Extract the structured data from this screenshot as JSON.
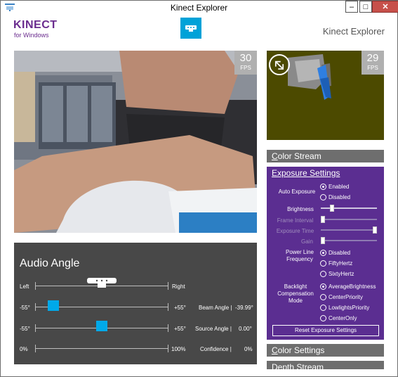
{
  "window": {
    "title": "Kinect Explorer",
    "minimize_glyph": "–",
    "maximize_glyph": "□",
    "close_glyph": "✕"
  },
  "header": {
    "logo_text": "KINECT",
    "logo_sub": "for Windows",
    "app_title": "Kinect Explorer"
  },
  "color_view": {
    "fps": "30",
    "fps_label": "FPS"
  },
  "depth_view": {
    "fps": "29",
    "fps_label": "FPS"
  },
  "audio": {
    "title": "Audio Angle",
    "left_label": "Left",
    "right_label": "Right",
    "beam": {
      "min": "-55°",
      "max": "+55°",
      "label": "Beam Angle |",
      "value": "-39.99°",
      "fraction": 0.136
    },
    "source": {
      "min": "-55°",
      "max": "+55°",
      "label": "Source Angle |",
      "value": "0.00°",
      "fraction": 0.5
    },
    "confidence": {
      "min": "0%",
      "max": "100%",
      "label": "Confidence |",
      "value": "0%"
    }
  },
  "sections": {
    "color_stream": "Color Stream",
    "color_stream_key": "C",
    "color_stream_rest": "olor Stream",
    "exposure_settings": "Exposure Settings",
    "color_settings_key": "C",
    "color_settings_rest": "olor Settings",
    "depth_stream_key": "D",
    "depth_stream_rest": "epth Stream"
  },
  "exposure": {
    "auto_exposure_label": "Auto Exposure",
    "auto_exposure_options": [
      "Enabled",
      "Disabled"
    ],
    "auto_exposure_selected": "Enabled",
    "brightness_label": "Brightness",
    "brightness_fraction": 0.2,
    "frame_interval_label": "Frame Interval",
    "exposure_time_label": "Exposure Time",
    "gain_label": "Gain",
    "power_line_label": "Power Line Frequency",
    "power_line_options": [
      "Disabled",
      "FiftyHertz",
      "SixtyHertz"
    ],
    "power_line_selected": "Disabled",
    "backlight_label": "Backlight Compensation Mode",
    "backlight_options": [
      "AverageBrightness",
      "CenterPriority",
      "LowlightsPriority",
      "CenterOnly"
    ],
    "backlight_selected": "AverageBrightness",
    "reset_label": "Reset Exposure Settings"
  },
  "colors": {
    "accent_purple": "#5b2e91",
    "kinect_blue": "#00a9e9",
    "audio_bg": "#484848"
  }
}
